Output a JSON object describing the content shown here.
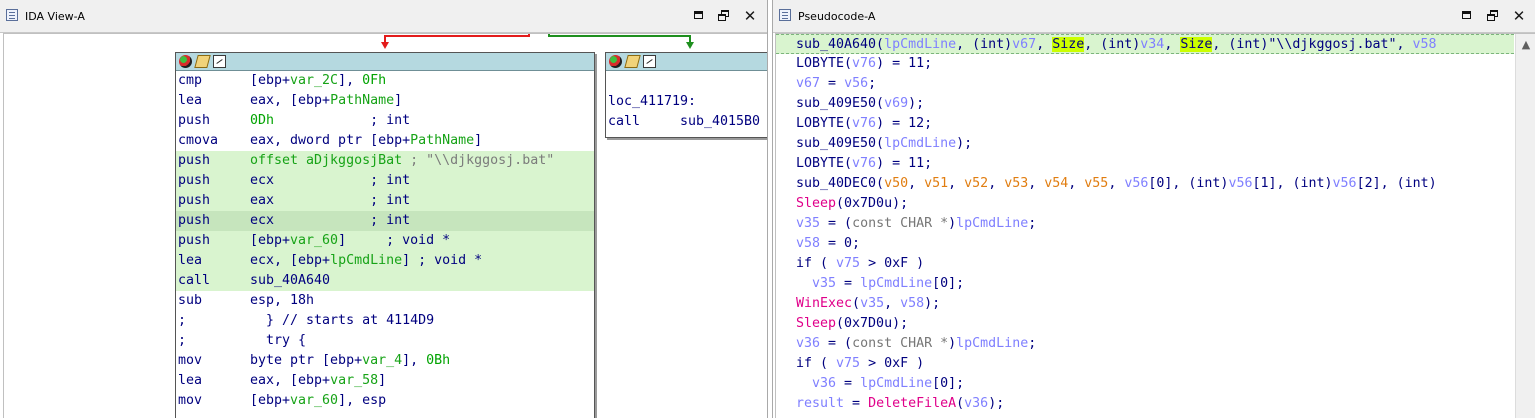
{
  "ida": {
    "title": "IDA View-A",
    "main_block": {
      "rows": [
        {
          "m": "cmp",
          "ops": [
            {
              "t": "[ebp+",
              "c": "plain"
            },
            {
              "t": "var_2C",
              "c": "op-var"
            },
            {
              "t": "], ",
              "c": "plain"
            },
            {
              "t": "0Fh",
              "c": "op-num"
            }
          ]
        },
        {
          "m": "lea",
          "ops": [
            {
              "t": "eax, [ebp+",
              "c": "plain"
            },
            {
              "t": "PathName",
              "c": "op-var"
            },
            {
              "t": "]",
              "c": "plain"
            }
          ]
        },
        {
          "m": "push",
          "ops": [
            {
              "t": "0Dh",
              "c": "op-num"
            },
            {
              "t": "            ; int",
              "c": "plain"
            }
          ]
        },
        {
          "m": "cmova",
          "ops": [
            {
              "t": "eax, dword ptr [ebp+",
              "c": "plain"
            },
            {
              "t": "PathName",
              "c": "op-var"
            },
            {
              "t": "]",
              "c": "plain"
            }
          ]
        },
        {
          "m": "push",
          "hl": "hl",
          "ops": [
            {
              "t": "offset aDjkggosjBat",
              "c": "op-var"
            },
            {
              "t": " ; \"\\\\djkggosj.bat\"",
              "c": "cmt"
            }
          ]
        },
        {
          "m": "push",
          "hl": "hl",
          "ops": [
            {
              "t": "ecx",
              "c": "plain"
            },
            {
              "t": "            ; int",
              "c": "plain"
            }
          ]
        },
        {
          "m": "push",
          "hl": "hl",
          "ops": [
            {
              "t": "eax",
              "c": "plain"
            },
            {
              "t": "            ; int",
              "c": "plain"
            }
          ]
        },
        {
          "m": "push",
          "hl": "hl2",
          "ops": [
            {
              "t": "ecx",
              "c": "plain"
            },
            {
              "t": "            ; int",
              "c": "plain"
            }
          ]
        },
        {
          "m": "push",
          "hl": "hl",
          "ops": [
            {
              "t": "[ebp+",
              "c": "plain"
            },
            {
              "t": "var_60",
              "c": "op-var"
            },
            {
              "t": "]     ; void *",
              "c": "plain"
            }
          ]
        },
        {
          "m": "lea",
          "hl": "hl",
          "ops": [
            {
              "t": "ecx, [ebp+",
              "c": "plain"
            },
            {
              "t": "lpCmdLine",
              "c": "op-var"
            },
            {
              "t": "] ; void *",
              "c": "plain"
            }
          ]
        },
        {
          "m": "call",
          "hl": "hl",
          "ops": [
            {
              "t": "sub_40A640",
              "c": "plain"
            }
          ]
        },
        {
          "m": "sub",
          "ops": [
            {
              "t": "esp, 18h",
              "c": "plain"
            }
          ]
        },
        {
          "m": ";",
          "ops": [
            {
              "t": "  } // starts at 4114D9",
              "c": "plain"
            }
          ]
        },
        {
          "m": ";",
          "ops": [
            {
              "t": "  try {",
              "c": "plain"
            }
          ]
        },
        {
          "m": "mov",
          "ops": [
            {
              "t": "byte ptr [ebp+",
              "c": "plain"
            },
            {
              "t": "var_4",
              "c": "op-var"
            },
            {
              "t": "], ",
              "c": "plain"
            },
            {
              "t": "0Bh",
              "c": "op-num"
            }
          ]
        },
        {
          "m": "lea",
          "ops": [
            {
              "t": "eax, [ebp+",
              "c": "plain"
            },
            {
              "t": "var_58",
              "c": "op-var"
            },
            {
              "t": "]",
              "c": "plain"
            }
          ]
        },
        {
          "m": "mov",
          "ops": [
            {
              "t": "[ebp+",
              "c": "plain"
            },
            {
              "t": "var_60",
              "c": "op-var"
            },
            {
              "t": "], esp",
              "c": "plain"
            }
          ]
        }
      ]
    },
    "side_block": {
      "label": "loc_411719:",
      "call_mnemonic": "call",
      "call_target": "sub_4015B0"
    }
  },
  "pseudo": {
    "title": "Pseudocode-A",
    "lines": [
      [
        {
          "t": "sub_40A640(",
          "c": "fn"
        },
        {
          "t": "lpCmdLine",
          "c": "var"
        },
        {
          "t": ", (int)",
          "c": "plain"
        },
        {
          "t": "v67",
          "c": "var"
        },
        {
          "t": ", ",
          "c": "plain"
        },
        {
          "t": "Size",
          "c": "sz"
        },
        {
          "t": ", (int)",
          "c": "plain"
        },
        {
          "t": "v34",
          "c": "var"
        },
        {
          "t": ", ",
          "c": "plain"
        },
        {
          "t": "Size",
          "c": "sz"
        },
        {
          "t": ", (int)\"\\\\djkggosj.bat\", ",
          "c": "plain"
        },
        {
          "t": "v58",
          "c": "var"
        }
      ],
      [
        {
          "t": "LOBYTE(",
          "c": "fn"
        },
        {
          "t": "v76",
          "c": "var"
        },
        {
          "t": ") = 11;",
          "c": "plain"
        }
      ],
      [
        {
          "t": "v67",
          "c": "var"
        },
        {
          "t": " = ",
          "c": "plain"
        },
        {
          "t": "v56",
          "c": "var"
        },
        {
          "t": ";",
          "c": "plain"
        }
      ],
      [
        {
          "t": "sub_409E50(",
          "c": "fn"
        },
        {
          "t": "v69",
          "c": "var"
        },
        {
          "t": ");",
          "c": "plain"
        }
      ],
      [
        {
          "t": "LOBYTE(",
          "c": "fn"
        },
        {
          "t": "v76",
          "c": "var"
        },
        {
          "t": ") = 12;",
          "c": "plain"
        }
      ],
      [
        {
          "t": "sub_409E50(",
          "c": "fn"
        },
        {
          "t": "lpCmdLine",
          "c": "var"
        },
        {
          "t": ");",
          "c": "plain"
        }
      ],
      [
        {
          "t": "LOBYTE(",
          "c": "fn"
        },
        {
          "t": "v76",
          "c": "var"
        },
        {
          "t": ") = 11;",
          "c": "plain"
        }
      ],
      [
        {
          "t": "sub_40DEC0(",
          "c": "fn"
        },
        {
          "t": "v50",
          "c": "arg"
        },
        {
          "t": ", ",
          "c": "plain"
        },
        {
          "t": "v51",
          "c": "arg"
        },
        {
          "t": ", ",
          "c": "plain"
        },
        {
          "t": "v52",
          "c": "arg"
        },
        {
          "t": ", ",
          "c": "plain"
        },
        {
          "t": "v53",
          "c": "arg"
        },
        {
          "t": ", ",
          "c": "plain"
        },
        {
          "t": "v54",
          "c": "arg"
        },
        {
          "t": ", ",
          "c": "plain"
        },
        {
          "t": "v55",
          "c": "arg"
        },
        {
          "t": ", ",
          "c": "plain"
        },
        {
          "t": "v56",
          "c": "var"
        },
        {
          "t": "[0], (int)",
          "c": "plain"
        },
        {
          "t": "v56",
          "c": "var"
        },
        {
          "t": "[1], (int)",
          "c": "plain"
        },
        {
          "t": "v56",
          "c": "var"
        },
        {
          "t": "[2], (int)",
          "c": "plain"
        }
      ],
      [
        {
          "t": "Sleep",
          "c": "fn2"
        },
        {
          "t": "(0x7D0u);",
          "c": "plain"
        }
      ],
      [
        {
          "t": "v35",
          "c": "var"
        },
        {
          "t": " = (",
          "c": "plain"
        },
        {
          "t": "const CHAR *",
          "c": "typ"
        },
        {
          "t": ")",
          "c": "plain"
        },
        {
          "t": "lpCmdLine",
          "c": "var"
        },
        {
          "t": ";",
          "c": "plain"
        }
      ],
      [
        {
          "t": "v58",
          "c": "var"
        },
        {
          "t": " = 0;",
          "c": "plain"
        }
      ],
      [
        {
          "t": "if ( ",
          "c": "kw"
        },
        {
          "t": "v75",
          "c": "var"
        },
        {
          "t": " > 0xF )",
          "c": "plain"
        }
      ],
      [
        {
          "t": "  v35",
          "c": "var"
        },
        {
          "t": " = ",
          "c": "plain"
        },
        {
          "t": "lpCmdLine",
          "c": "var"
        },
        {
          "t": "[0];",
          "c": "plain"
        }
      ],
      [
        {
          "t": "WinExec",
          "c": "fn2"
        },
        {
          "t": "(",
          "c": "plain"
        },
        {
          "t": "v35",
          "c": "var"
        },
        {
          "t": ", ",
          "c": "plain"
        },
        {
          "t": "v58",
          "c": "var"
        },
        {
          "t": ");",
          "c": "plain"
        }
      ],
      [
        {
          "t": "Sleep",
          "c": "fn2"
        },
        {
          "t": "(0x7D0u);",
          "c": "plain"
        }
      ],
      [
        {
          "t": "v36",
          "c": "var"
        },
        {
          "t": " = (",
          "c": "plain"
        },
        {
          "t": "const CHAR *",
          "c": "typ"
        },
        {
          "t": ")",
          "c": "plain"
        },
        {
          "t": "lpCmdLine",
          "c": "var"
        },
        {
          "t": ";",
          "c": "plain"
        }
      ],
      [
        {
          "t": "if ( ",
          "c": "kw"
        },
        {
          "t": "v75",
          "c": "var"
        },
        {
          "t": " > 0xF )",
          "c": "plain"
        }
      ],
      [
        {
          "t": "  v36",
          "c": "var"
        },
        {
          "t": " = ",
          "c": "plain"
        },
        {
          "t": "lpCmdLine",
          "c": "var"
        },
        {
          "t": "[0];",
          "c": "plain"
        }
      ],
      [
        {
          "t": "result",
          "c": "var"
        },
        {
          "t": " = ",
          "c": "plain"
        },
        {
          "t": "DeleteFileA",
          "c": "fn2"
        },
        {
          "t": "(",
          "c": "plain"
        },
        {
          "t": "v36",
          "c": "var"
        },
        {
          "t": ");",
          "c": "plain"
        }
      ]
    ]
  },
  "window_buttons": {
    "minimize": "",
    "restore": "",
    "close": "✕"
  },
  "colors": {
    "node_header": "#b5d9e0",
    "highlight": "#d9f4cf",
    "edge_false": "#e31b1b",
    "edge_true": "#1e8f1e"
  }
}
